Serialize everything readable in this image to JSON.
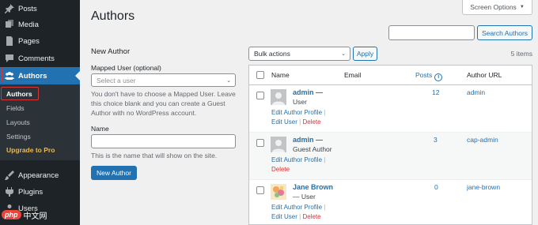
{
  "sidebar": {
    "items": [
      {
        "label": "Posts",
        "icon": "pin-icon"
      },
      {
        "label": "Media",
        "icon": "media-icon"
      },
      {
        "label": "Pages",
        "icon": "pages-icon"
      },
      {
        "label": "Comments",
        "icon": "comment-icon"
      },
      {
        "label": "Authors",
        "icon": "users-group-icon"
      },
      {
        "label": "Appearance",
        "icon": "brush-icon"
      },
      {
        "label": "Plugins",
        "icon": "plugin-icon"
      },
      {
        "label": "Users",
        "icon": "user-icon"
      }
    ],
    "submenu": [
      "Authors",
      "Fields",
      "Layouts",
      "Settings",
      "Upgrade to Pro"
    ],
    "active_color": "#2271b1",
    "highlight_color": "#d63638"
  },
  "watermark": {
    "badge": "php",
    "text": "中文网"
  },
  "page": {
    "title": "Authors"
  },
  "screen_options": {
    "label": "Screen Options"
  },
  "search": {
    "placeholder": "",
    "button": "Search Authors"
  },
  "new_author": {
    "heading": "New Author",
    "mapped_label": "Mapped User (optional)",
    "mapped_placeholder": "Select a user",
    "mapped_help": "You don't have to choose a Mapped User. Leave this choice blank and you can create a Guest Author with no WordPress account.",
    "name_label": "Name",
    "name_help": "This is the name that will show on the site.",
    "submit": "New Author"
  },
  "bulk": {
    "selected": "Bulk actions",
    "apply": "Apply",
    "count": "5 items"
  },
  "table": {
    "headers": {
      "name": "Name",
      "email": "Email",
      "posts": "Posts",
      "url": "Author URL"
    },
    "info_glyph": "i",
    "rows": [
      {
        "name": "admin",
        "sep": "—",
        "role": "User",
        "posts": "12",
        "url": "admin",
        "actions": [
          "Edit Author Profile",
          "Edit User",
          "Delete"
        ]
      },
      {
        "name": "admin",
        "sep": "—",
        "role": "Guest Author",
        "posts": "3",
        "url": "cap-admin",
        "actions": [
          "Edit Author Profile",
          "Delete"
        ]
      },
      {
        "name": "Jane Brown",
        "sep": "—",
        "role": "User",
        "posts": "0",
        "url": "jane-brown",
        "actions": [
          "Edit Author Profile",
          "Edit User",
          "Delete"
        ]
      }
    ]
  },
  "separators": {
    "pipe": "|",
    "caret": "▼",
    "chevron": "⌄"
  }
}
